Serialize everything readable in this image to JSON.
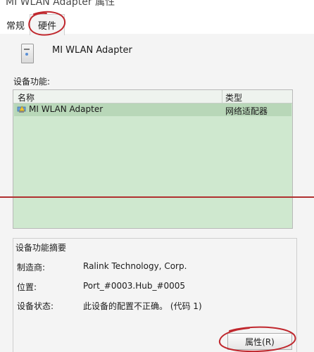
{
  "window": {
    "title": "MI WLAN Adapter 属性"
  },
  "tabs": [
    {
      "label": "常规"
    },
    {
      "label": "硬件"
    }
  ],
  "device": {
    "name": "MI WLAN Adapter",
    "icon": "usb-adapter-icon"
  },
  "functions": {
    "label": "设备功能:",
    "columns": [
      "名称",
      "类型"
    ],
    "rows": [
      {
        "name": "MI WLAN Adapter",
        "type": "网络适配器",
        "icon": "network-adapter-warning-icon"
      }
    ]
  },
  "summary": {
    "title": "设备功能摘要",
    "items": [
      {
        "label": "制造商:",
        "value": "Ralink Technology, Corp."
      },
      {
        "label": "位置:",
        "value": "Port_#0003.Hub_#0005"
      },
      {
        "label": "设备状态:",
        "value": "此设备的配置不正确。 (代码 1)"
      }
    ]
  },
  "buttons": {
    "properties": "属性(R)"
  },
  "colors": {
    "list_background": "#cfe8cf",
    "selected_row": "#b8d7b8",
    "annotation_red": "#c0272d"
  }
}
